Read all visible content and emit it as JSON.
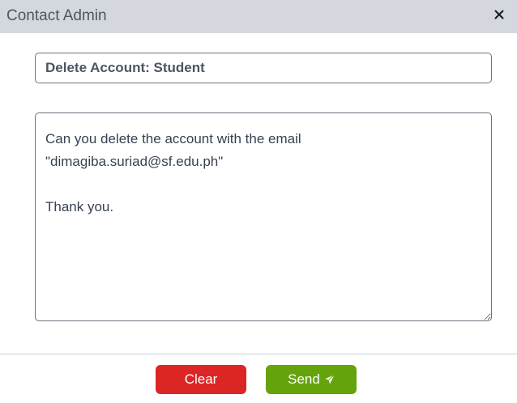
{
  "modal": {
    "title": "Contact Admin",
    "close_icon": "close-icon"
  },
  "form": {
    "subject_value": "Delete Account: Student",
    "message_value": "Can you delete the account with the email\n\"dimagiba.suriad@sf.edu.ph\"\n\nThank you."
  },
  "footer": {
    "clear_label": "Clear",
    "send_label": "Send",
    "send_icon": "paper-plane-icon"
  },
  "colors": {
    "header_bg": "#d4d8de",
    "clear": "#dc2626",
    "send": "#65a30d"
  }
}
